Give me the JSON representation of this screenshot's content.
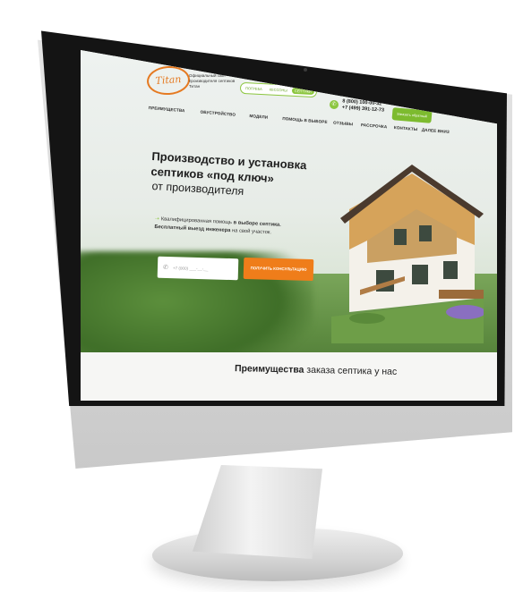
{
  "site": {
    "logo_text": "Titan",
    "logo_caption": "Официальный сайт производителя септиков Титан"
  },
  "header": {
    "pills": [
      "ПОГРЕБА",
      "КЕССОНЫ",
      "СЕПТИКИ"
    ],
    "active_pill": "СЕПТИКИ",
    "phones": [
      "8 (800) 100-00-32",
      "+7 (499) 391-12-73"
    ],
    "callback_label": "Заказать обратный звонок"
  },
  "nav": {
    "items": [
      {
        "label": "ПРЕИМУЩЕСТВА"
      },
      {
        "label": "ОБУСТРОЙСТВО"
      },
      {
        "label": "МОДЕЛИ"
      },
      {
        "label": "ПОМОЩЬ В ВЫБОРЕ"
      },
      {
        "label": "ОТЗЫВЫ"
      },
      {
        "label": "РАССРОЧКА"
      },
      {
        "label": "КОНТАКТЫ"
      },
      {
        "label": "ДАЛЕЕ ВНИЗ"
      }
    ]
  },
  "hero": {
    "title_line1": "Производство и установка",
    "title_line2": "септиков «под ключ»",
    "subtitle": "от производителя",
    "desc_line1_pre": "Квалифицированная помощь ",
    "desc_line1_bold": "в выборе септика.",
    "desc_line2_bold": "Бесплатный выезд инженера",
    "desc_line2_post": " на свой участок."
  },
  "form": {
    "phone_placeholder": "+7 (000) ___-__-__",
    "submit_label": "ПОЛУЧИТЬ КОНСУЛЬТАЦИЮ"
  },
  "section": {
    "title_bold": "Преимущества",
    "title_rest": " заказа септика у нас"
  },
  "colors": {
    "brand_orange": "#ef7d1a",
    "brand_green": "#8cc63f",
    "bezel": "#141414"
  },
  "icons": [
    "phone-icon",
    "leaf-icon",
    "phone-field-icon",
    "camera-dot"
  ]
}
